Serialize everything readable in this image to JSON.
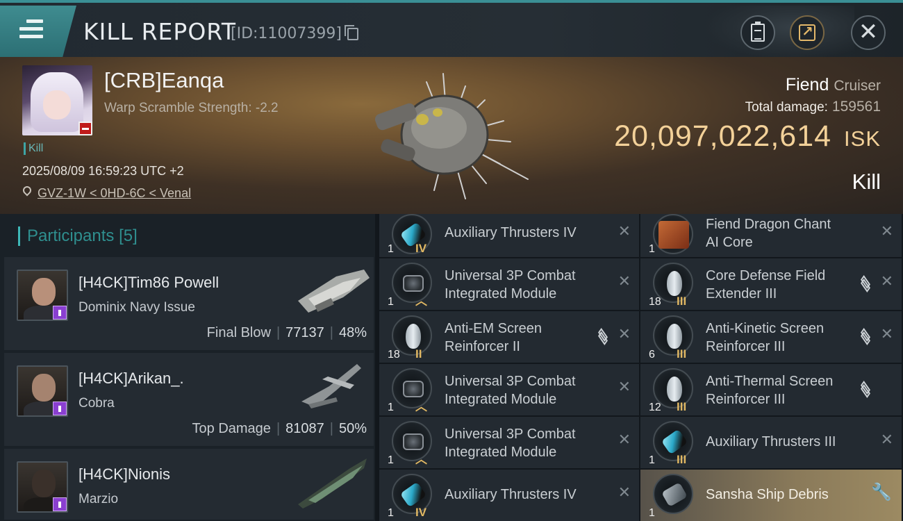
{
  "header": {
    "title": "KILL REPORT",
    "report_id": "[ID:11007399]"
  },
  "victim": {
    "pilot_name": "[CRB]Eanqa",
    "warp_scramble": "Warp Scramble Strength: -2.2",
    "tag": "Kill",
    "datetime": "2025/08/09 16:59:23 UTC +2",
    "location": "GVZ-1W < 0HD-6C < Venal",
    "ship_name": "Fiend",
    "ship_class": "Cruiser",
    "total_damage_label": "Total damage:",
    "total_damage": "159561",
    "isk_value": "20,097,022,614",
    "isk_unit": "ISK",
    "result": "Kill"
  },
  "participants": {
    "label": "Participants",
    "count": "[5]",
    "list": [
      {
        "name": "[H4CK]Tim86 Powell",
        "ship": "Dominix Navy Issue",
        "role": "Final Blow",
        "damage": "77137",
        "percent": "48%"
      },
      {
        "name": "[H4CK]Arikan_.",
        "ship": "Cobra",
        "role": "Top Damage",
        "damage": "81087",
        "percent": "50%"
      },
      {
        "name": "[H4CK]Nionis",
        "ship": "Marzio"
      }
    ]
  },
  "modules": {
    "col1": [
      {
        "qty": "1",
        "meta": "IV",
        "name_l1": "Auxiliary Thrusters IV",
        "name_l2": ""
      },
      {
        "qty": "1",
        "meta": "",
        "name_l1": "Universal 3P Combat",
        "name_l2": "Integrated Module"
      },
      {
        "qty": "18",
        "meta": "II",
        "name_l1": "Anti-EM Screen",
        "name_l2": "Reinforcer II"
      },
      {
        "qty": "1",
        "meta": "",
        "name_l1": "Universal 3P Combat",
        "name_l2": "Integrated Module"
      },
      {
        "qty": "1",
        "meta": "",
        "name_l1": "Universal 3P Combat",
        "name_l2": "Integrated Module"
      },
      {
        "qty": "1",
        "meta": "IV",
        "name_l1": "Auxiliary Thrusters IV",
        "name_l2": ""
      }
    ],
    "col2": [
      {
        "qty": "1",
        "meta": "",
        "name_l1": "Fiend Dragon Chant",
        "name_l2": "AI Core"
      },
      {
        "qty": "18",
        "meta": "III",
        "name_l1": "Core Defense Field",
        "name_l2": "Extender III"
      },
      {
        "qty": "6",
        "meta": "III",
        "name_l1": "Anti-Kinetic Screen",
        "name_l2": "Reinforcer III"
      },
      {
        "qty": "12",
        "meta": "III",
        "name_l1": "Anti-Thermal Screen",
        "name_l2": "Reinforcer III"
      },
      {
        "qty": "1",
        "meta": "III",
        "name_l1": "Auxiliary Thrusters III",
        "name_l2": ""
      },
      {
        "qty": "1",
        "meta": "",
        "name_l1": "Sansha Ship Debris",
        "name_l2": ""
      }
    ]
  },
  "icons": {
    "menu": "hamburger-icon",
    "copy": "copy-icon",
    "clipboard": "clipboard-icon",
    "share": "share-icon",
    "close": "close-icon",
    "location": "map-pin-icon",
    "stack": "stack-icon",
    "remove": "x-icon",
    "wrench": "wrench-icon"
  },
  "colors": {
    "accent": "#3a8f95",
    "isk": "#f3d199",
    "corp_badge": "#8a3fd0",
    "meta_gold": "#e1b863"
  }
}
